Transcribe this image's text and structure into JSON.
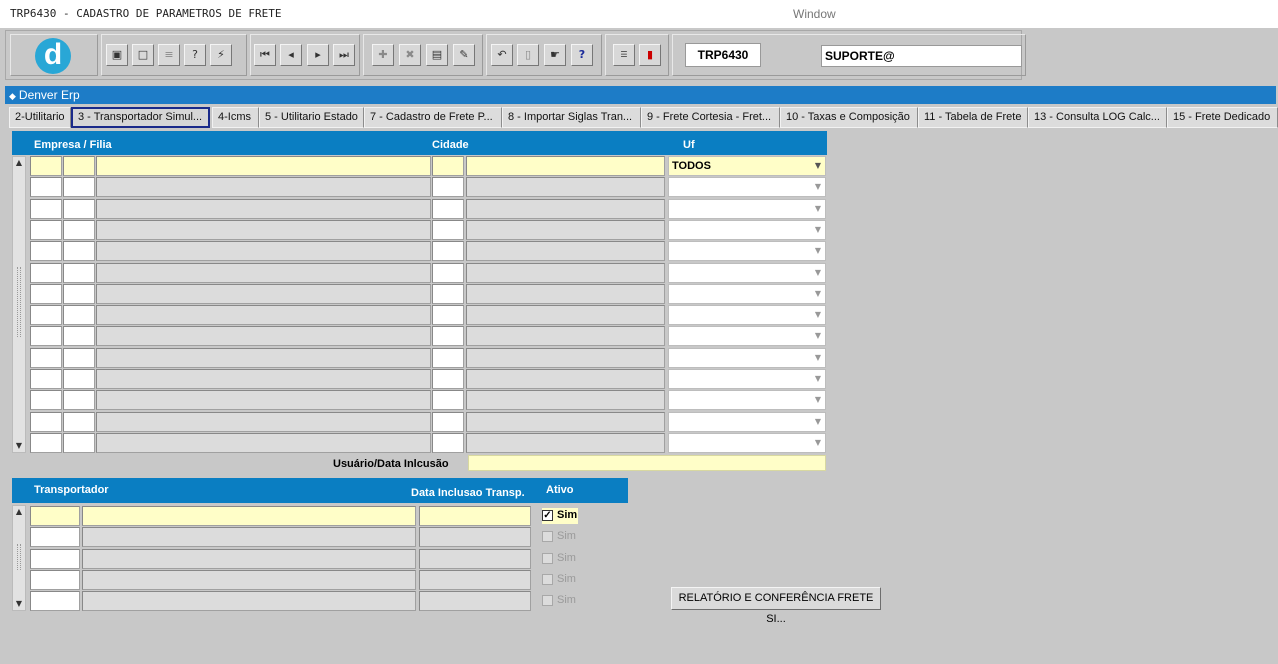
{
  "window": {
    "title": "TRP6430 - CADASTRO DE PARAMETROS DE FRETE",
    "center_label": "Window"
  },
  "toolbar": {
    "form_code": "TRP6430",
    "user": "SUPORTE@",
    "buttons": [
      "save-icon",
      "window-icon",
      "print-icon",
      "query-help-icon",
      "execute-query-icon",
      "first-record-icon",
      "previous-record-icon",
      "next-record-icon",
      "last-record-icon",
      "insert-record-icon",
      "delete-record-icon",
      "clear-form-icon",
      "edit-icon",
      "undo-icon",
      "clipboard-icon",
      "tools-icon",
      "help-icon",
      "menu-icon",
      "exit-icon"
    ],
    "logo_letter": "d"
  },
  "app": {
    "name": "Denver Erp"
  },
  "tabs": [
    "2-Utilitario",
    "3 - Transportador Simul...",
    "4-Icms",
    "5 - Utilitario Estado",
    "7 - Cadastro de Frete P...",
    "8 - Importar Siglas Tran...",
    "9 - Frete Cortesia - Fret...",
    "10 - Taxas e Composição",
    "11 - Tabela de Frete",
    "13 - Consulta LOG Calc...",
    "15 - Frete Dedicado"
  ],
  "active_tab_index": 1,
  "grid1": {
    "headers": {
      "empresa": "Empresa / Filia",
      "cidade": "Cidade",
      "uf": "Uf"
    },
    "first_row_uf": "TODOS",
    "row_count": 14,
    "usuario_label": "Usuário/Data Inlcusão"
  },
  "grid2": {
    "headers": {
      "transportador": "Transportador",
      "data_inclusao": "Data Inclusao Transp.",
      "ativo": "Ativo"
    },
    "checkbox_label": "Sim",
    "row_count": 5
  },
  "report_button": "RELATÓRIO E CONFERÊNCIA FRETE SI..."
}
